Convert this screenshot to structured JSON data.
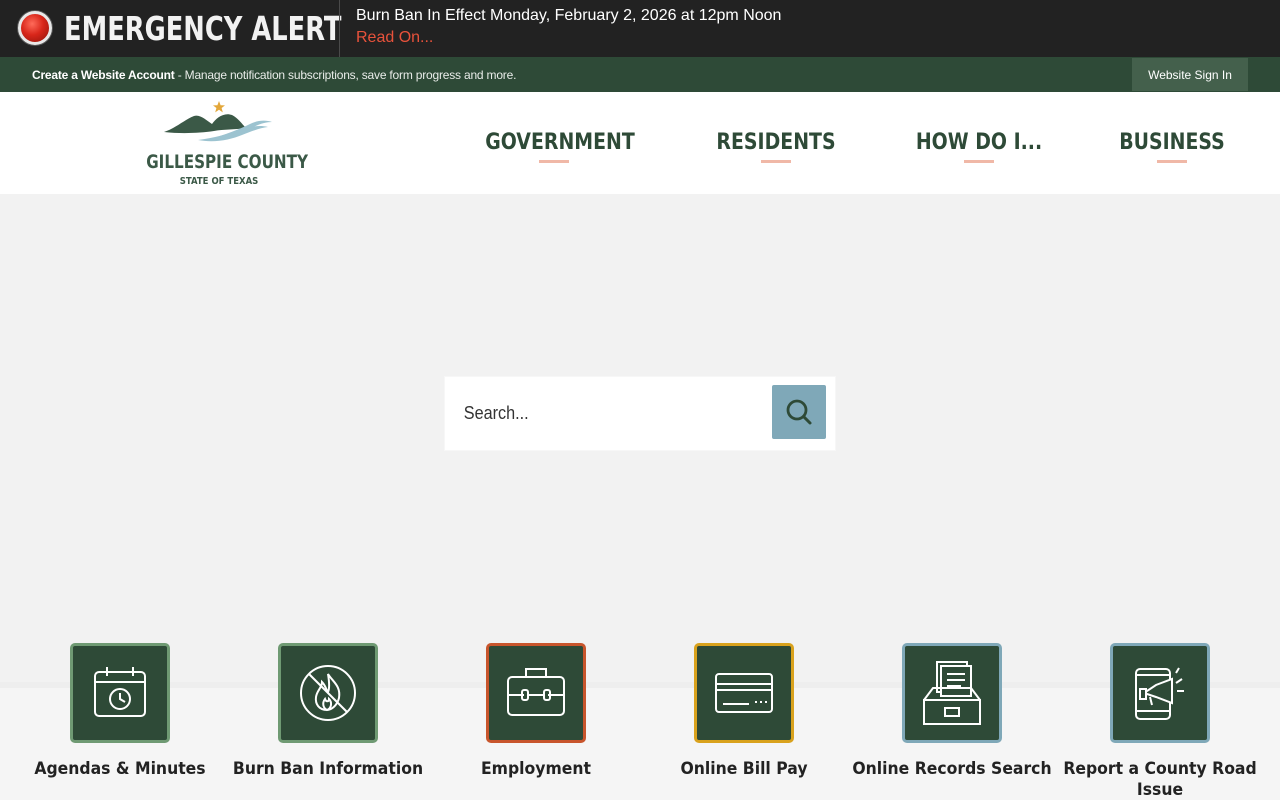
{
  "alert": {
    "title": "EMERGENCY ALERT",
    "message": "Burn Ban In Effect Monday, February 2, 2026 at 12pm Noon",
    "link": "Read On..."
  },
  "account_bar": {
    "create_account": "Create a Website Account",
    "description": " - Manage notification subscriptions, save form progress and more.",
    "sign_in": "Website Sign In"
  },
  "logo": {
    "name": "GILLESPIE COUNTY",
    "subtitle": "STATE OF TEXAS"
  },
  "nav": {
    "items": [
      {
        "label": "GOVERNMENT"
      },
      {
        "label": "RESIDENTS"
      },
      {
        "label": "HOW DO I..."
      },
      {
        "label": "BUSINESS"
      }
    ]
  },
  "search": {
    "placeholder": "Search..."
  },
  "quick_links": [
    {
      "label": "Agendas & Minutes",
      "icon": "calendar-clock-icon",
      "border": "#6f9a73"
    },
    {
      "label": "Burn Ban Information",
      "icon": "no-fire-icon",
      "border": "#6f9a73"
    },
    {
      "label": "Employment",
      "icon": "briefcase-icon",
      "border": "#c8552c"
    },
    {
      "label": "Online Bill Pay",
      "icon": "credit-card-icon",
      "border": "#d9a21d"
    },
    {
      "label": "Online Records Search",
      "icon": "file-box-icon",
      "border": "#7fa8b8"
    },
    {
      "label": "Report a County Road Issue",
      "icon": "megaphone-tablet-icon",
      "border": "#7fa8b8"
    }
  ],
  "colors": {
    "alert_bg": "#222222",
    "alert_link": "#e8523b",
    "brand_green": "#2e4a37",
    "search_button": "#7fa8b8",
    "nav_underline": "#f0b8a7"
  }
}
